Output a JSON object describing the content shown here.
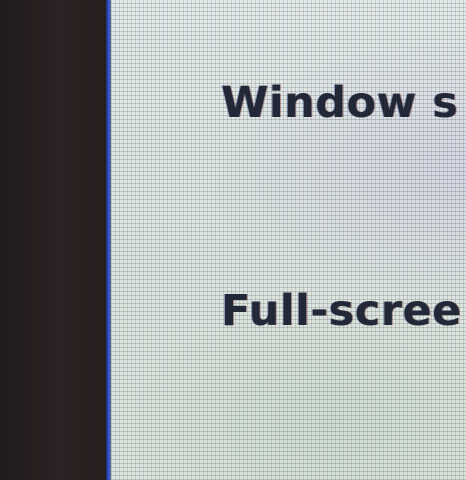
{
  "display_options": {
    "items": [
      {
        "label": "Window s"
      },
      {
        "label": "Full-scree"
      }
    ]
  }
}
